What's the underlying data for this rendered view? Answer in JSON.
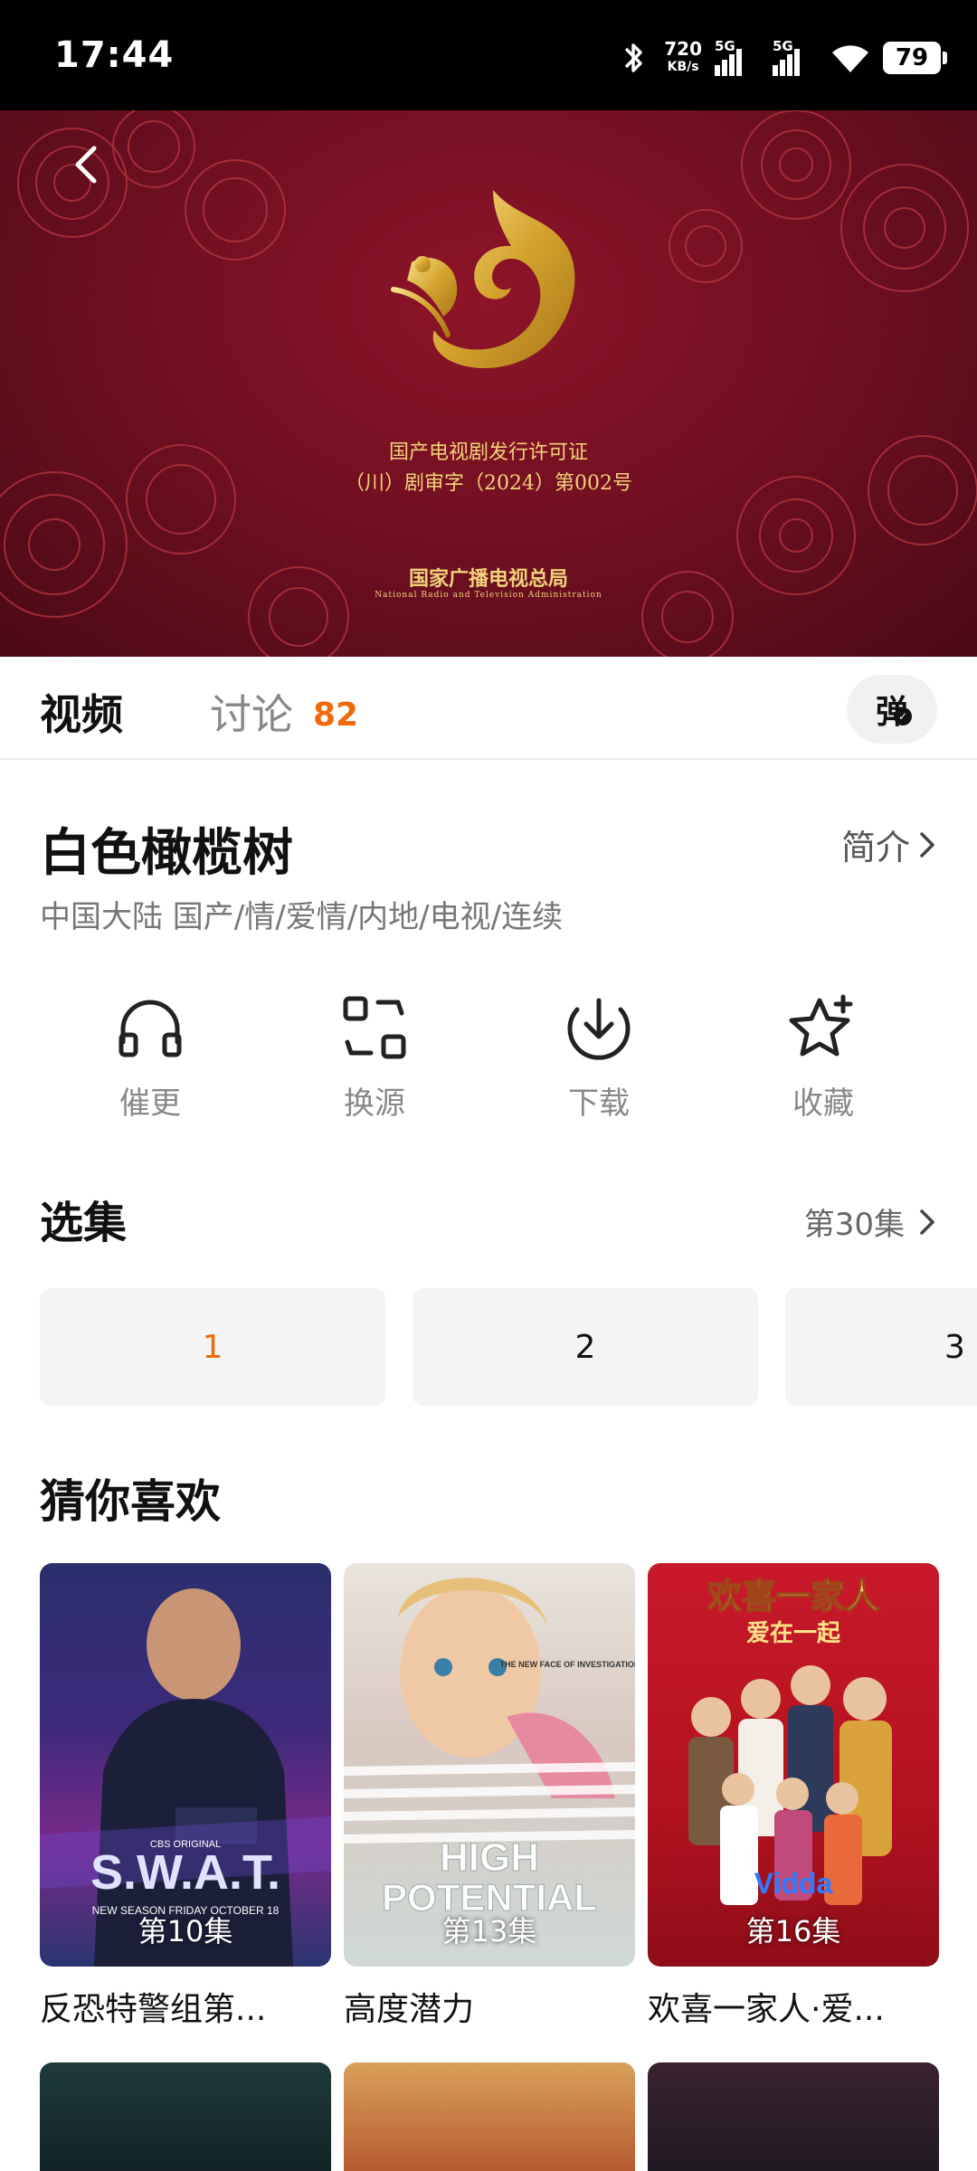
{
  "status": {
    "time": "17:44",
    "net_speed": "720",
    "net_unit": "KB/s",
    "sig1": "5G",
    "sig2": "5G",
    "battery": "79"
  },
  "video": {
    "license_line1": "国产电视剧发行许可证",
    "license_line2": "（川）剧审字（2024）第002号",
    "org_cn": "国家广播电视总局",
    "org_en": "National Radio and Television Administration"
  },
  "tabs": {
    "video": "视频",
    "discuss": "讨论",
    "discuss_count": "82",
    "danmu": "弹"
  },
  "show": {
    "title": "白色橄榄树",
    "intro": "简介",
    "tags": "中国大陆  国产/情/爱情/内地/电视/连续"
  },
  "actions": [
    {
      "label": "催更",
      "icon": "headphones-icon"
    },
    {
      "label": "换源",
      "icon": "switch-source-icon"
    },
    {
      "label": "下载",
      "icon": "download-icon"
    },
    {
      "label": "收藏",
      "icon": "star-add-icon"
    }
  ],
  "episodes": {
    "title": "选集",
    "current": "第30集",
    "items": [
      "1",
      "2",
      "3"
    ]
  },
  "recommend": {
    "title": "猜你喜欢",
    "items": [
      {
        "name": "反恐特警组第...",
        "episode": "第10集"
      },
      {
        "name": "高度潜力",
        "episode": "第13集"
      },
      {
        "name": "欢喜一家人·爱...",
        "episode": "第16集"
      }
    ],
    "poster_text": {
      "swat_top": "CBS ORIGINAL",
      "swat_title": "S.W.A.T.",
      "swat_sub": "NEW SEASON FRIDAY OCTOBER 18",
      "high_tag": "THE NEW FACE OF INVESTIGATION",
      "high_title1": "HIGH",
      "high_title2": "POTENTIAL",
      "family_title1": "欢喜一家人",
      "family_title2": "爱在一起",
      "family_brand": "Vidda"
    }
  }
}
